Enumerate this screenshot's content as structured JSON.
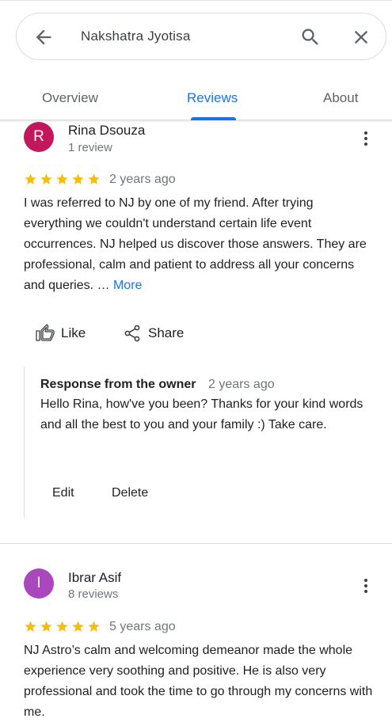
{
  "search": {
    "query": "Nakshatra Jyotisa",
    "back_icon": "arrow-left-icon",
    "search_icon": "search-icon",
    "clear_icon": "close-icon"
  },
  "tabs": [
    {
      "label": "Overview",
      "active": false
    },
    {
      "label": "Reviews",
      "active": true
    },
    {
      "label": "About",
      "active": false
    }
  ],
  "colors": {
    "accent": "#1a73e8",
    "star": "#fbbc04",
    "avatar_r": "#c2185b",
    "avatar_i": "#ab47bc"
  },
  "reviews": [
    {
      "avatar_letter": "R",
      "name": "Rina Dsouza",
      "review_count": "1 review",
      "rating": 5,
      "date": "2 years ago",
      "text": "I was referred to NJ by one of my friend. After trying everything we couldn't understand certain life event occurrences. NJ helped us discover those answers. They are professional, calm and patient to address all your concerns and queries. …",
      "more_label": "More",
      "like_label": "Like",
      "share_label": "Share",
      "owner_response": {
        "title": "Response from the owner",
        "date": "2 years ago",
        "text": "Hello Rina, how've you been? Thanks for your kind words and all the best to you and your family :) Take care.",
        "edit_label": "Edit",
        "delete_label": "Delete"
      }
    },
    {
      "avatar_letter": "I",
      "name": "Ibrar Asif",
      "review_count": "8 reviews",
      "rating": 5,
      "date": "5 years ago",
      "text": "NJ Astro’s calm and welcoming demeanor made the whole experience very soothing and positive. He is also very professional and took the time to go through my concerns with me."
    }
  ]
}
